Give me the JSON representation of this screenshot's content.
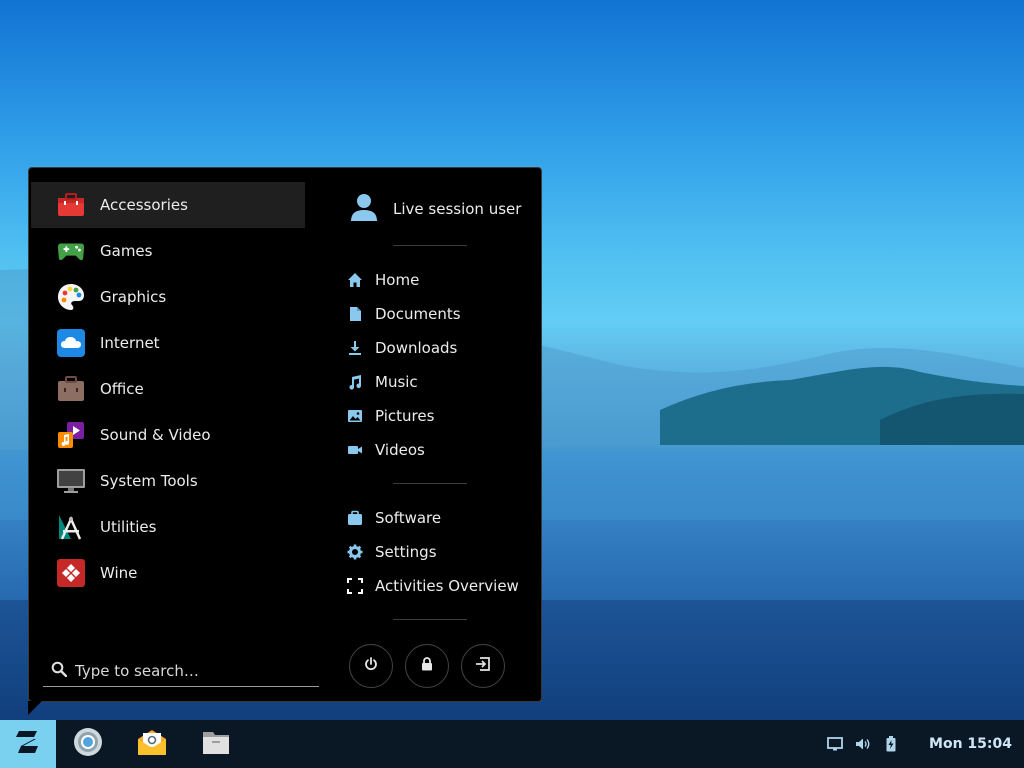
{
  "menu": {
    "categories": [
      {
        "label": "Accessories",
        "icon": "accessories-icon"
      },
      {
        "label": "Games",
        "icon": "games-icon"
      },
      {
        "label": "Graphics",
        "icon": "graphics-icon"
      },
      {
        "label": "Internet",
        "icon": "internet-icon"
      },
      {
        "label": "Office",
        "icon": "office-icon"
      },
      {
        "label": "Sound & Video",
        "icon": "sound-video-icon"
      },
      {
        "label": "System Tools",
        "icon": "system-tools-icon"
      },
      {
        "label": "Utilities",
        "icon": "utilities-icon"
      },
      {
        "label": "Wine",
        "icon": "wine-icon"
      }
    ],
    "search": {
      "placeholder": "Type to search…",
      "value": ""
    },
    "user": {
      "name": "Live session user"
    },
    "places": [
      {
        "label": "Home",
        "icon": "home-icon"
      },
      {
        "label": "Documents",
        "icon": "documents-icon"
      },
      {
        "label": "Downloads",
        "icon": "downloads-icon"
      },
      {
        "label": "Music",
        "icon": "music-icon"
      },
      {
        "label": "Pictures",
        "icon": "pictures-icon"
      },
      {
        "label": "Videos",
        "icon": "videos-icon"
      }
    ],
    "system": [
      {
        "label": "Software",
        "icon": "software-icon"
      },
      {
        "label": "Settings",
        "icon": "settings-icon"
      },
      {
        "label": "Activities Overview",
        "icon": "activities-overview-icon"
      }
    ],
    "power_buttons": [
      {
        "name": "power-button",
        "icon": "power-icon"
      },
      {
        "name": "lock-button",
        "icon": "lock-icon"
      },
      {
        "name": "logout-button",
        "icon": "logout-icon"
      }
    ]
  },
  "taskbar": {
    "apps": [
      {
        "name": "chromium",
        "icon": "chromium-icon"
      },
      {
        "name": "mail",
        "icon": "mail-icon"
      },
      {
        "name": "files",
        "icon": "files-icon"
      }
    ],
    "tray": [
      "display-icon",
      "volume-icon",
      "battery-icon"
    ],
    "clock": "Mon 15:04"
  },
  "colors": {
    "menu_bg": "#000000",
    "active_bg": "#1f1f1f",
    "start_button": "#7ad0ef",
    "taskbar_bg": "#0a1724",
    "accent_icon": "#8ac8ee"
  }
}
